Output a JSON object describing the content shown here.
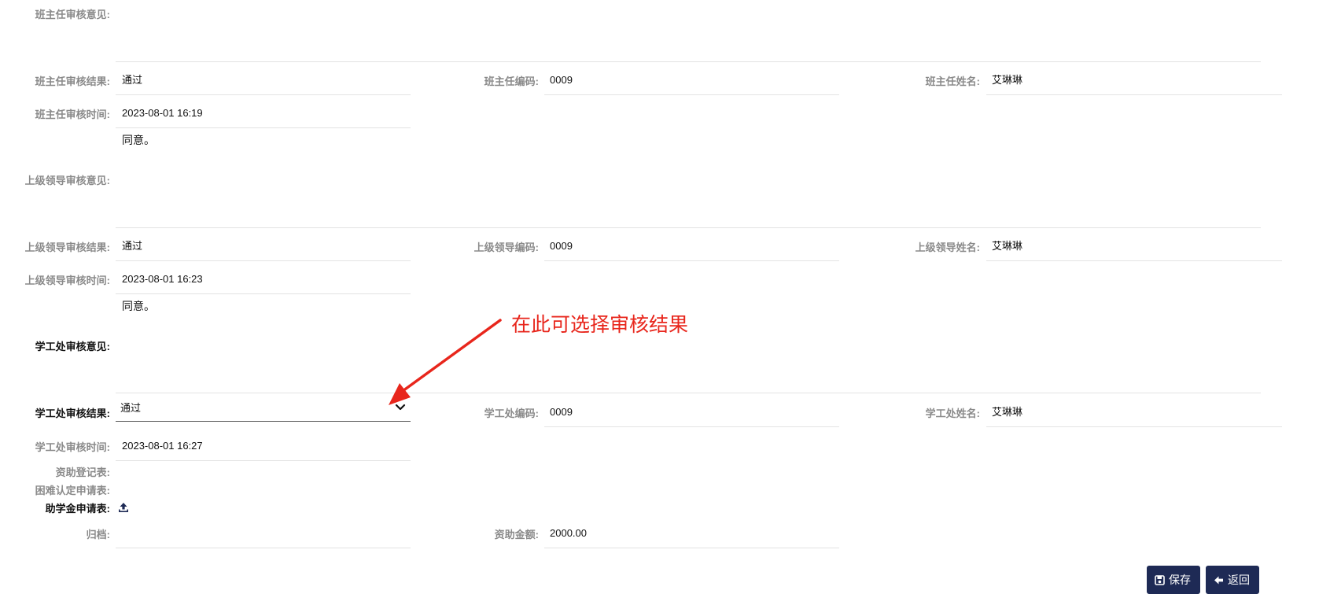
{
  "class_teacher": {
    "opinion_label": "班主任审核意见:",
    "result_label": "班主任审核结果:",
    "result_value": "通过",
    "code_label": "班主任编码:",
    "code_value": "0009",
    "name_label": "班主任姓名:",
    "name_value": "艾琳琳",
    "time_label": "班主任审核时间:",
    "time_value": "2023-08-01 16:19"
  },
  "superior": {
    "opinion_text": "同意。",
    "opinion_label": "上级领导审核意见:",
    "result_label": "上级领导审核结果:",
    "result_value": "通过",
    "code_label": "上级领导编码:",
    "code_value": "0009",
    "name_label": "上级领导姓名:",
    "name_value": "艾琳琳",
    "time_label": "上级领导审核时间:",
    "time_value": "2023-08-01 16:23"
  },
  "student_affairs": {
    "opinion_text": "同意。",
    "opinion_label": "学工处审核意见:",
    "result_label": "学工处审核结果:",
    "result_value": "通过",
    "code_label": "学工处编码:",
    "code_value": "0009",
    "name_label": "学工处姓名:",
    "name_value": "艾琳琳",
    "time_label": "学工处审核时间:",
    "time_value": "2023-08-01 16:27"
  },
  "attachments": {
    "aid_registration_label": "资助登记表:",
    "hardship_label": "困难认定申请表:",
    "grant_label": "助学金申请表:",
    "archive_label": "归档:",
    "amount_label": "资助金额:",
    "amount_value": "2000.00"
  },
  "annotation": {
    "text": "在此可选择审核结果",
    "color": "#e8261c"
  },
  "buttons": {
    "save_label": "保存",
    "back_label": "返回",
    "color": "#1e2a55"
  },
  "icons": {
    "chevron": "chevron-down-icon",
    "upload": "upload-icon",
    "save": "floppy-disk-icon",
    "back": "arrow-left-icon"
  }
}
